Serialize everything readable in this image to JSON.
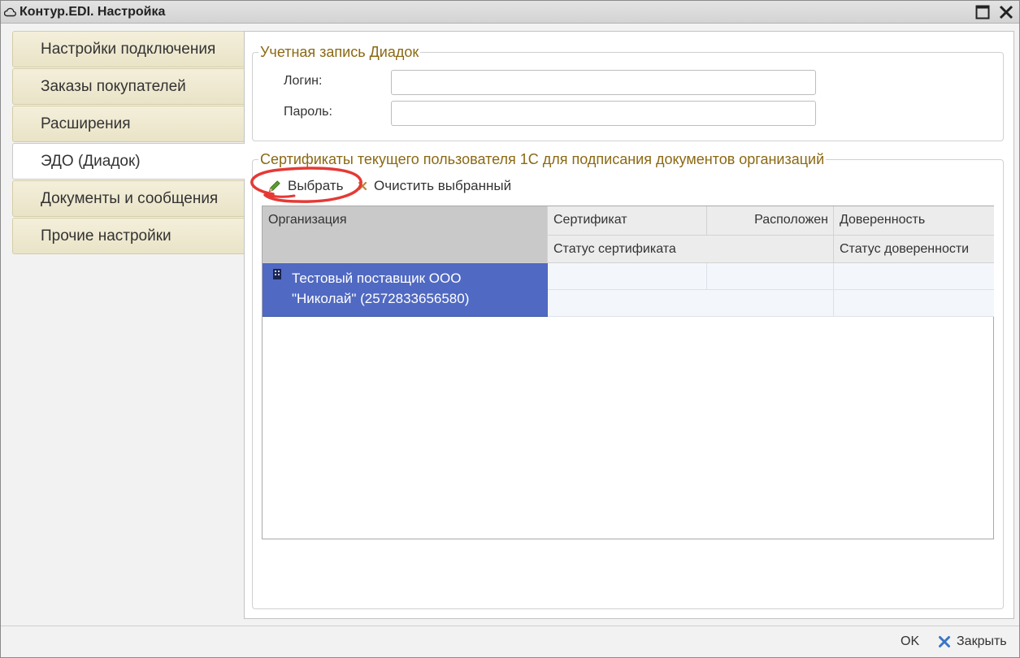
{
  "window": {
    "title": "Контур.EDI. Настройка",
    "title_icon": "cloud-icon",
    "maximize_icon": "maximize-icon",
    "close_icon": "close-icon"
  },
  "tabs": {
    "items": [
      {
        "label": "Настройки подключения"
      },
      {
        "label": "Заказы покупателей"
      },
      {
        "label": "Расширения"
      },
      {
        "label": "ЭДО (Диадок)"
      },
      {
        "label": "Документы и сообщения"
      },
      {
        "label": "Прочие настройки"
      }
    ],
    "active": "ЭДО (Диадок)"
  },
  "account": {
    "legend": "Учетная запись Диадок",
    "login_label": "Логин:",
    "login_value": "",
    "password_label": "Пароль:",
    "password_value": ""
  },
  "certificates": {
    "legend": "Сертификаты текущего пользователя 1С для подписания документов организаций",
    "toolbar": {
      "select_label": "Выбрать",
      "select_icon": "pencil-icon",
      "clear_label": "Очистить выбранный",
      "clear_icon": "clear-x-icon"
    },
    "table": {
      "headers": {
        "organization": "Организация",
        "certificate": "Сертификат",
        "location": "Расположен",
        "power_of_attorney": "Доверенность",
        "certificate_status": "Статус сертификата",
        "poa_status": "Статус доверенности"
      },
      "rows": [
        {
          "organization_icon": "building-icon",
          "organization_lines": [
            "Тестовый поставщик ООО",
            "\"Николай\" (2572833656580)"
          ],
          "selected": true
        }
      ]
    }
  },
  "footer": {
    "ok_label": "OK",
    "close_label": "Закрыть",
    "close_icon": "close-x-icon"
  },
  "colors": {
    "legend": "#8b6914",
    "tab_background": "#efe9cf",
    "selection": "#5069c2",
    "annotation": "#e53935",
    "pencil": "#5a9e2f",
    "footer_close": "#3a75c4"
  }
}
